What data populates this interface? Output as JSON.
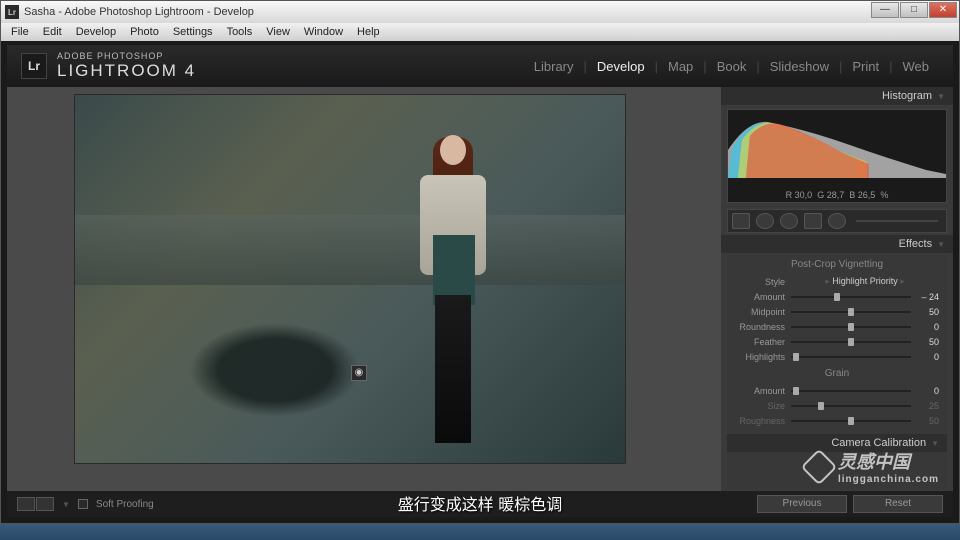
{
  "window": {
    "title": "Sasha - Adobe Photoshop Lightroom - Develop",
    "controls": {
      "min": "—",
      "max": "□",
      "close": "✕"
    }
  },
  "menubar": [
    "File",
    "Edit",
    "Develop",
    "Photo",
    "Settings",
    "Tools",
    "View",
    "Window",
    "Help"
  ],
  "brand": {
    "small": "ADOBE PHOTOSHOP",
    "big": "LIGHTROOM 4",
    "logo": "Lr"
  },
  "modules": [
    "Library",
    "Develop",
    "Map",
    "Book",
    "Slideshow",
    "Print",
    "Web"
  ],
  "active_module": "Develop",
  "bottom": {
    "soft_proofing": "Soft Proofing"
  },
  "right": {
    "histogram_label": "Histogram",
    "readout": {
      "r": "30,0",
      "g": "28,7",
      "b": "26,5",
      "pct": "%"
    },
    "effects_label": "Effects",
    "vignette_title": "Post-Crop Vignetting",
    "style_label": "Style",
    "style_value": "Highlight Priority",
    "sliders": [
      {
        "label": "Amount",
        "value": "– 24",
        "pos": 38
      },
      {
        "label": "Midpoint",
        "value": "50",
        "pos": 50
      },
      {
        "label": "Roundness",
        "value": "0",
        "pos": 50
      },
      {
        "label": "Feather",
        "value": "50",
        "pos": 50
      },
      {
        "label": "Highlights",
        "value": "0",
        "pos": 4
      }
    ],
    "grain_title": "Grain",
    "grain": [
      {
        "label": "Amount",
        "value": "0",
        "pos": 4,
        "dim": false
      },
      {
        "label": "Size",
        "value": "25",
        "pos": 25,
        "dim": true
      },
      {
        "label": "Roughness",
        "value": "50",
        "pos": 50,
        "dim": true
      }
    ],
    "calib_label": "Camera Calibration",
    "previous": "Previous",
    "reset": "Reset"
  },
  "watermark": {
    "text": "灵感中国",
    "sub": "lingganchina.com"
  },
  "subtitle": "盛行变成这样 暖棕色调"
}
